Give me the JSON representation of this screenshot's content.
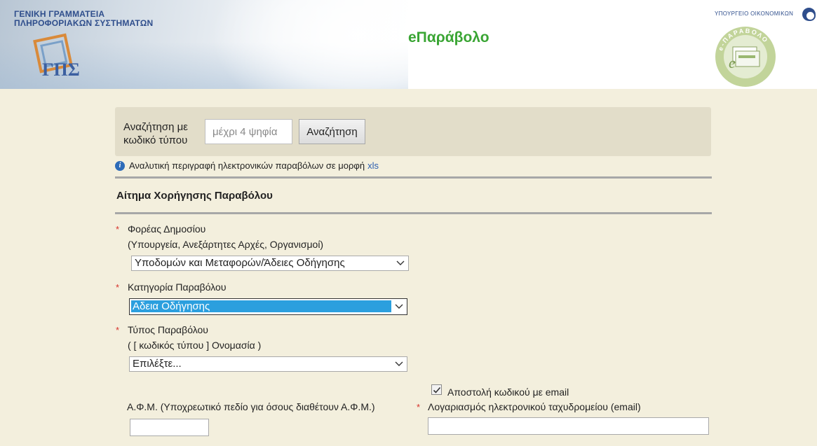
{
  "header": {
    "org_line1": "ΓΕΝΙΚΗ ΓΡΑΜΜΑΤΕΙΑ",
    "org_line2": "ΠΛΗΡΟΦΟΡΙΑΚΩΝ ΣΥΣΤΗΜΑΤΩΝ",
    "app_title": "eΠαράβολο",
    "ministry": "ΥΠΟΥΡΓΕΙΟ ΟΙΚΟΝΟΜΙΚΩΝ",
    "seal_text": "e-ΠΑΡΑΒΟΛΟ"
  },
  "search": {
    "label_line1": "Αναζήτηση με",
    "label_line2": "κωδικό τύπου",
    "placeholder": "μέχρι 4 ψηφία",
    "button": "Αναζήτηση"
  },
  "info": {
    "text": "Αναλυτική περιγραφή ηλεκτρονικών παραβόλων σε μορφή",
    "link": "xls"
  },
  "form": {
    "title": "Αίτημα Χορήγησης Παραβόλου",
    "required_mark": "*",
    "agency": {
      "label": "Φορέας Δημοσίου",
      "hint": "(Υπουργεία, Ανεξάρτητες Αρχές, Οργανισμοί)",
      "value": "Υποδομών και Μεταφορών/Άδειες Οδήγησης"
    },
    "category": {
      "label": "Κατηγορία Παραβόλου",
      "value": "Αδεια Οδήγησης"
    },
    "type": {
      "label": "Τύπος Παραβόλου",
      "hint": "( [ κωδικός τύπου ] Ονομασία )",
      "value": "Επιλέξτε..."
    },
    "afm": {
      "label": "Α.Φ.Μ. (Υποχρεωτικό πεδίο για όσους διαθέτουν Α.Φ.Μ.)",
      "value": ""
    },
    "send_code": {
      "label": "Αποστολή κωδικού με email",
      "checked": true
    },
    "email": {
      "label": "Λογαριασμός ηλεκτρονικού ταχυδρομείου (email)",
      "value": ""
    }
  }
}
